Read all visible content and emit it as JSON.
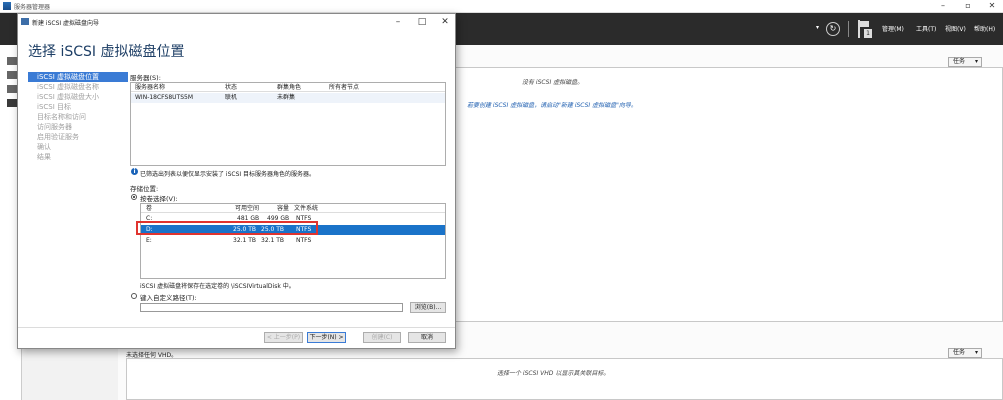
{
  "server_manager": {
    "window_title": "服务器管理器",
    "header_menu": {
      "manage": "管理(M)",
      "tools": "工具(T)",
      "view": "视图(V)",
      "help": "帮助(H)"
    },
    "notification_count": "1",
    "top_panel": {
      "tasks_label": "任务",
      "empty_message": "没有 iSCSI 虚拟磁盘。",
      "create_hint": "若要创建 iSCSI 虚拟磁盘，请启动\"新建 iSCSI 虚拟磁盘\"向导。"
    },
    "bottom_panel": {
      "status_text": "未选择任何 VHD。",
      "tasks_label": "任务",
      "select_hint": "选择一个 iSCSI VHD 以显示其关联目标。"
    }
  },
  "dialog": {
    "title": "新建 iSCSI 虚拟磁盘向导",
    "heading": "选择 iSCSI 虚拟磁盘位置",
    "steps": [
      {
        "label": "iSCSI 虚拟磁盘位置",
        "active": true
      },
      {
        "label": "iSCSI 虚拟磁盘名称",
        "active": false
      },
      {
        "label": "iSCSI 虚拟磁盘大小",
        "active": false
      },
      {
        "label": "iSCSI 目标",
        "active": false
      },
      {
        "label": "目标名称和访问",
        "active": false
      },
      {
        "label": "访问服务器",
        "active": false
      },
      {
        "label": "启用验证服务",
        "active": false
      },
      {
        "label": "确认",
        "active": false
      },
      {
        "label": "结果",
        "active": false
      }
    ],
    "server_label": "服务器(S):",
    "server_grid": {
      "headers": [
        "服务器名称",
        "状态",
        "群集角色",
        "所有者节点"
      ],
      "rows": [
        [
          "WIN-18CFS8UTS5M",
          "联机",
          "未群集",
          ""
        ]
      ]
    },
    "filter_note": "已筛选出列表以便仅显示安装了 iSCSI 目标服务器角色的服务器。",
    "storage_label": "存储位置:",
    "select_by_volume_label": "按卷选择(V):",
    "volume_grid": {
      "headers": [
        "卷",
        "可用空间",
        "容量",
        "文件系统"
      ],
      "rows": [
        [
          "C:",
          "481 GB",
          "499 GB",
          "NTFS"
        ],
        [
          "D:",
          "25.0 TB",
          "25.0 TB",
          "NTFS"
        ],
        [
          "E:",
          "32.1 TB",
          "32.1 TB",
          "NTFS"
        ]
      ],
      "selected_index": 1
    },
    "save_note": "iSCSI 虚拟磁盘将保存在选定卷的 \\iSCSIVirtualDisk 中。",
    "custom_path_label": "键入自定义路径(T):",
    "custom_path_value": "",
    "browse_label": "浏览(B)...",
    "buttons": {
      "prev": "< 上一步(P)",
      "next": "下一步(N) >",
      "create": "创建(C)",
      "cancel": "取消"
    }
  }
}
